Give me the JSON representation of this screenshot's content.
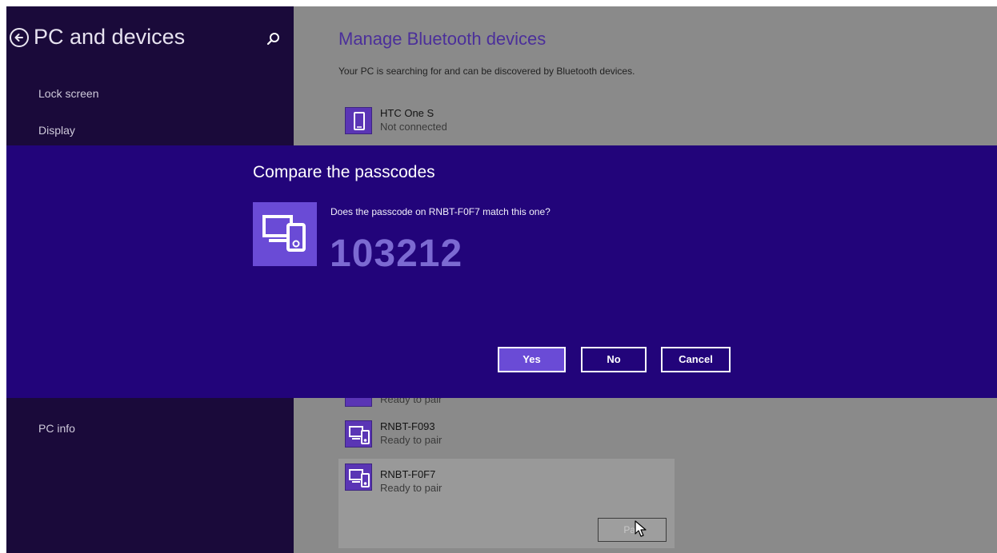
{
  "left_pane": {
    "title": "PC and devices",
    "nav": [
      "Lock screen",
      "Display",
      "PC info"
    ]
  },
  "right_pane": {
    "title": "Manage Bluetooth devices",
    "description": "Your PC is searching for and can be discovered by Bluetooth devices.",
    "devices": [
      {
        "name": "HTC One S",
        "status": "Not connected",
        "icon": "phone-icon"
      },
      {
        "name": "",
        "status": "Ready to pair",
        "icon": "pc-device-icon"
      },
      {
        "name": "RNBT-F093",
        "status": "Ready to pair",
        "icon": "pc-device-icon"
      },
      {
        "name": "RNBT-F0F7",
        "status": "Ready to pair",
        "icon": "pc-device-icon"
      }
    ],
    "pair_button": "Pair"
  },
  "dialog": {
    "title": "Compare the passcodes",
    "question": "Does the passcode on RNBT-F0F7 match this one?",
    "passcode": "103212",
    "buttons": {
      "yes": "Yes",
      "no": "No",
      "cancel": "Cancel"
    }
  },
  "colors": {
    "left_pane_bg": "#1a0a3a",
    "dialog_bg": "#22047a",
    "accent": "#6a4bd6",
    "passcode": "#7c6ad2",
    "right_pane_bg": "#8a8a8a"
  }
}
